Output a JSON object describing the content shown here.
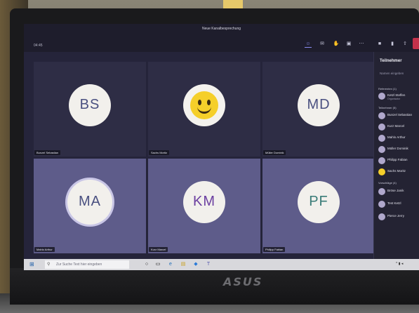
{
  "meeting": {
    "title": "Neue Kanalbesprechung",
    "timer": "04:45"
  },
  "toolbar": {
    "icons": [
      "people-icon",
      "chat-icon",
      "raise-hand-icon",
      "rooms-icon",
      "more-icon",
      "camera-off-icon",
      "mic-icon",
      "share-icon"
    ],
    "hangup_color": "#c4314b",
    "accent": "#8a8cf0"
  },
  "tiles": [
    {
      "initials": "BS",
      "name": "Bunzel Sebastian",
      "style": "navy"
    },
    {
      "initials": "",
      "name": "Sachs Moritz",
      "style": "emoji"
    },
    {
      "initials": "MD",
      "name": "Müller Dominik",
      "style": "navy"
    },
    {
      "initials": "MA",
      "name": "Mahlo Arthur",
      "style": "navy"
    },
    {
      "initials": "KM",
      "name": "Kurz Marcel",
      "style": "purple"
    },
    {
      "initials": "PF",
      "name": "Philipp Fabian",
      "style": "teal"
    }
  ],
  "panel": {
    "title": "Teilnehmer",
    "search_placeholder": "Namen eingeben",
    "sections": [
      {
        "label": "Referenten (1)"
      },
      {
        "label": "Teilnehmer (5)"
      },
      {
        "label": "Vorschläge (4)"
      }
    ],
    "presenters": [
      {
        "name": "Ketzl Steffen",
        "role": "Organisator"
      }
    ],
    "attendees": [
      {
        "name": "Bunzel Sebastian"
      },
      {
        "name": "Kurz Marcel"
      },
      {
        "name": "Mahlo Arthur"
      },
      {
        "name": "Müller Dominik"
      },
      {
        "name": "Philipp Fabian"
      },
      {
        "name": "Sachs Moritz"
      }
    ],
    "suggestions": [
      {
        "name": "Bröse Janik"
      },
      {
        "name": "Test Ketzl"
      },
      {
        "name": "Pierce Jerry"
      }
    ]
  },
  "taskbar": {
    "search_placeholder": "Zur Suche Text hier eingeben"
  },
  "brand": "ASUS"
}
